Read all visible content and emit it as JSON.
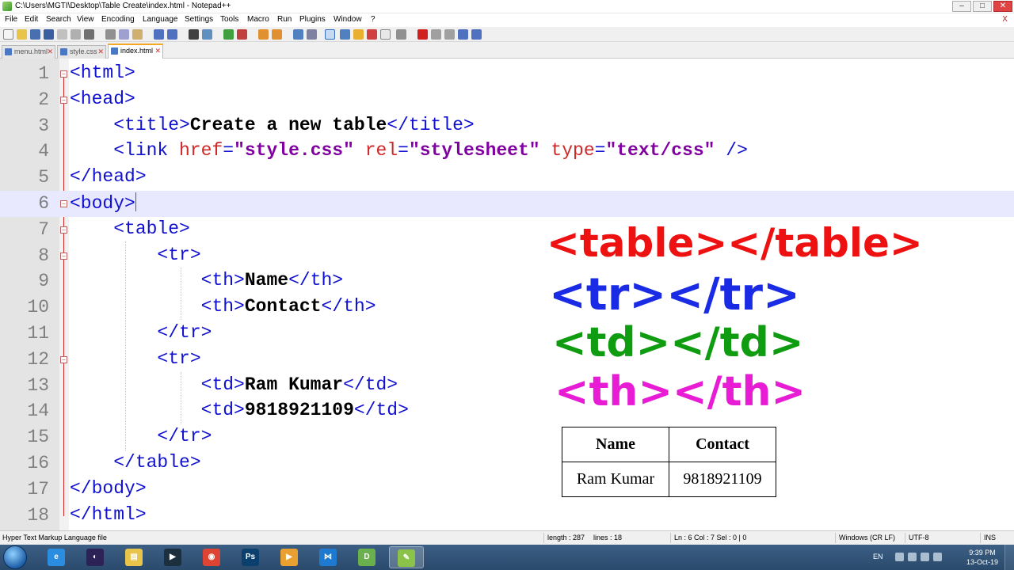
{
  "window": {
    "title": "C:\\Users\\MGTI\\Desktop\\Table Create\\index.html - Notepad++",
    "minimize": "–",
    "maximize": "□",
    "close": "✕"
  },
  "menu": {
    "items": [
      "File",
      "Edit",
      "Search",
      "View",
      "Encoding",
      "Language",
      "Settings",
      "Tools",
      "Macro",
      "Run",
      "Plugins",
      "Window",
      "?"
    ],
    "close_doc": "X"
  },
  "tabs": [
    {
      "label": "menu.html",
      "active": false
    },
    {
      "label": "style.css",
      "active": false
    },
    {
      "label": "index.html",
      "active": true
    }
  ],
  "tab_close": "✕",
  "code_lines": [
    {
      "n": "1",
      "fold": "⊟",
      "text": "<html>"
    },
    {
      "n": "2",
      "fold": "⊟",
      "text": "<head>"
    },
    {
      "n": "3",
      "fold": "",
      "text": "    <title>Create a new table</title>"
    },
    {
      "n": "4",
      "fold": "",
      "text": "    <link href=\"style.css\" rel=\"stylesheet\" type=\"text/css\" />"
    },
    {
      "n": "5",
      "fold": "",
      "text": "</head>"
    },
    {
      "n": "6",
      "fold": "⊟",
      "text": "<body>"
    },
    {
      "n": "7",
      "fold": "⊟",
      "text": "    <table>"
    },
    {
      "n": "8",
      "fold": "⊟",
      "text": "        <tr>"
    },
    {
      "n": "9",
      "fold": "",
      "text": "            <th>Name</th>"
    },
    {
      "n": "10",
      "fold": "",
      "text": "            <th>Contact</th>"
    },
    {
      "n": "11",
      "fold": "",
      "text": "        </tr>"
    },
    {
      "n": "12",
      "fold": "⊟",
      "text": "        <tr>"
    },
    {
      "n": "13",
      "fold": "",
      "text": "            <td>Ram Kumar</td>"
    },
    {
      "n": "14",
      "fold": "",
      "text": "            <td>9818921109</td>"
    },
    {
      "n": "15",
      "fold": "",
      "text": "        </tr>"
    },
    {
      "n": "16",
      "fold": "",
      "text": "    </table>"
    },
    {
      "n": "17",
      "fold": "",
      "text": "</body>"
    },
    {
      "n": "18",
      "fold": "",
      "text": "</html>"
    }
  ],
  "current_line": 6,
  "overlay": {
    "table_tag": "<table></table>",
    "tr_tag": "<tr></tr>",
    "td_tag": "<td></td>",
    "th_tag": "<th></th>",
    "colors": {
      "table": "#ee1111",
      "tr": "#1a2be6",
      "td": "#109c10",
      "th": "#e81cd4"
    }
  },
  "preview_table": {
    "headers": [
      "Name",
      "Contact"
    ],
    "rows": [
      [
        "Ram Kumar",
        "9818921109"
      ]
    ]
  },
  "statusbar": {
    "file_type": "Hyper Text Markup Language file",
    "length": "length : 287",
    "lines": "lines : 18",
    "position": "Ln : 6    Col : 7    Sel : 0 | 0",
    "eol": "Windows (CR LF)",
    "encoding": "UTF-8",
    "mode": "INS"
  },
  "taskbar": {
    "apps": [
      {
        "icon": "internet-explorer-icon",
        "color": "#2a8de0",
        "glyph": "e"
      },
      {
        "icon": "eclipse-icon",
        "color": "#2c2255",
        "glyph": "◐"
      },
      {
        "icon": "file-explorer-icon",
        "color": "#e8c44a",
        "glyph": "▤"
      },
      {
        "icon": "media-encoder-icon",
        "color": "#1c2f3f",
        "glyph": "▶"
      },
      {
        "icon": "chrome-icon",
        "color": "#dd4433",
        "glyph": "◉"
      },
      {
        "icon": "photoshop-icon",
        "color": "#0a3f6e",
        "glyph": "Ps"
      },
      {
        "icon": "media-player-icon",
        "color": "#e8a030",
        "glyph": "▶"
      },
      {
        "icon": "visual-studio-code-icon",
        "color": "#1e7ad0",
        "glyph": "⋈"
      },
      {
        "icon": "dreamweaver-icon",
        "color": "#6ab04c",
        "glyph": "D"
      },
      {
        "icon": "notepad-plus-plus-icon",
        "color": "#8bc34a",
        "glyph": "✎"
      }
    ],
    "active_index": 9,
    "language": "EN",
    "time": "9:39 PM",
    "date": "13-Oct-19"
  }
}
